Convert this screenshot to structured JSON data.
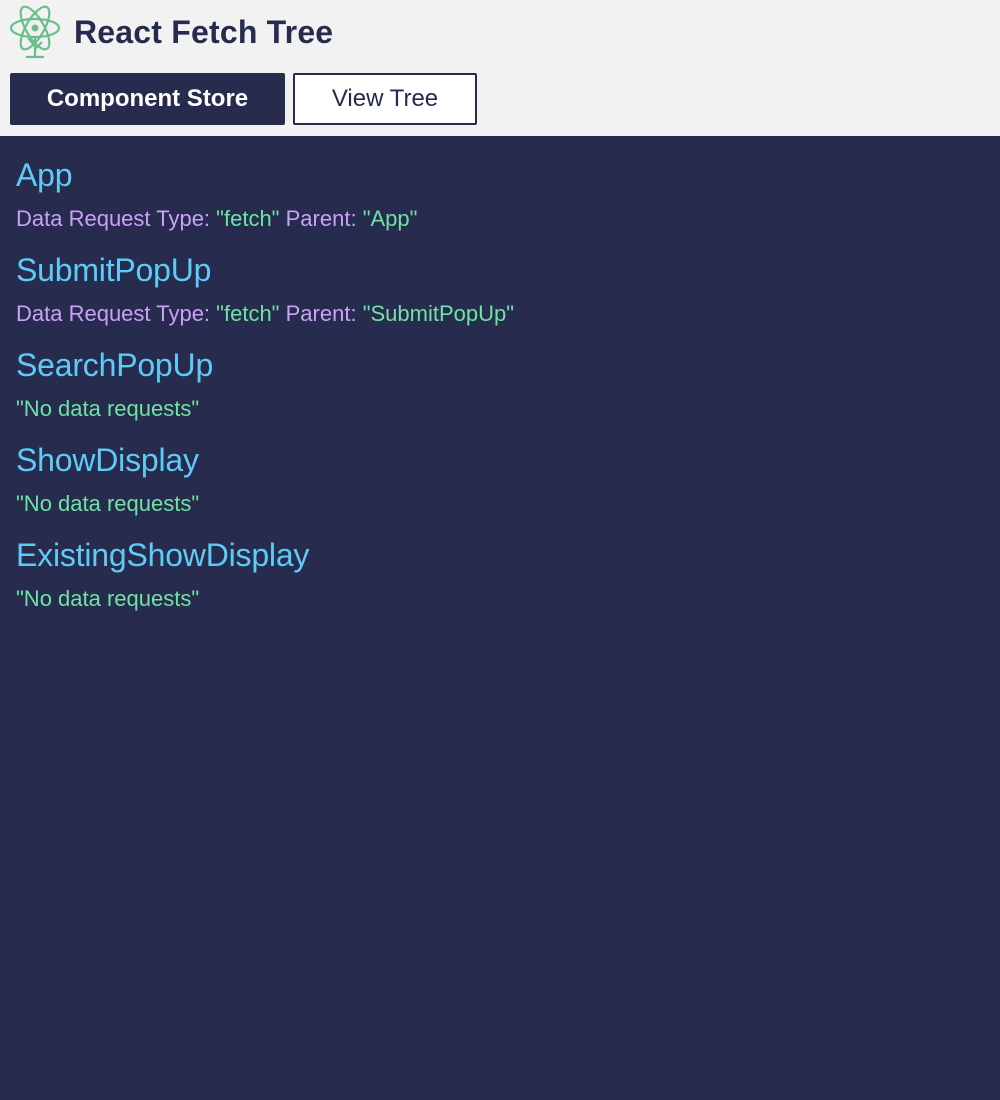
{
  "app": {
    "title": "React Fetch Tree",
    "logo_icon": "react-atom-icon"
  },
  "nav": {
    "component_store_label": "Component Store",
    "view_tree_label": "View Tree",
    "active_tab": "Component Store"
  },
  "labels": {
    "request_type": "Data Request Type:",
    "parent": "Parent:"
  },
  "components": [
    {
      "name": "App",
      "type_value": "\"fetch\"",
      "parent_value": "\"App\""
    },
    {
      "name": "SubmitPopUp",
      "type_value": "\"fetch\"",
      "parent_value": "\"SubmitPopUp\""
    },
    {
      "name": "SearchPopUp",
      "no_requests": "\"No data requests\""
    },
    {
      "name": "ShowDisplay",
      "no_requests": "\"No data requests\""
    },
    {
      "name": "ExistingShowDisplay",
      "no_requests": "\"No data requests\""
    }
  ],
  "colors": {
    "navy": "#272b4d",
    "component_name": "#5ecbf7",
    "label": "#c9a2f7",
    "value": "#6de3a4",
    "header_bg": "#f2f2f2"
  }
}
